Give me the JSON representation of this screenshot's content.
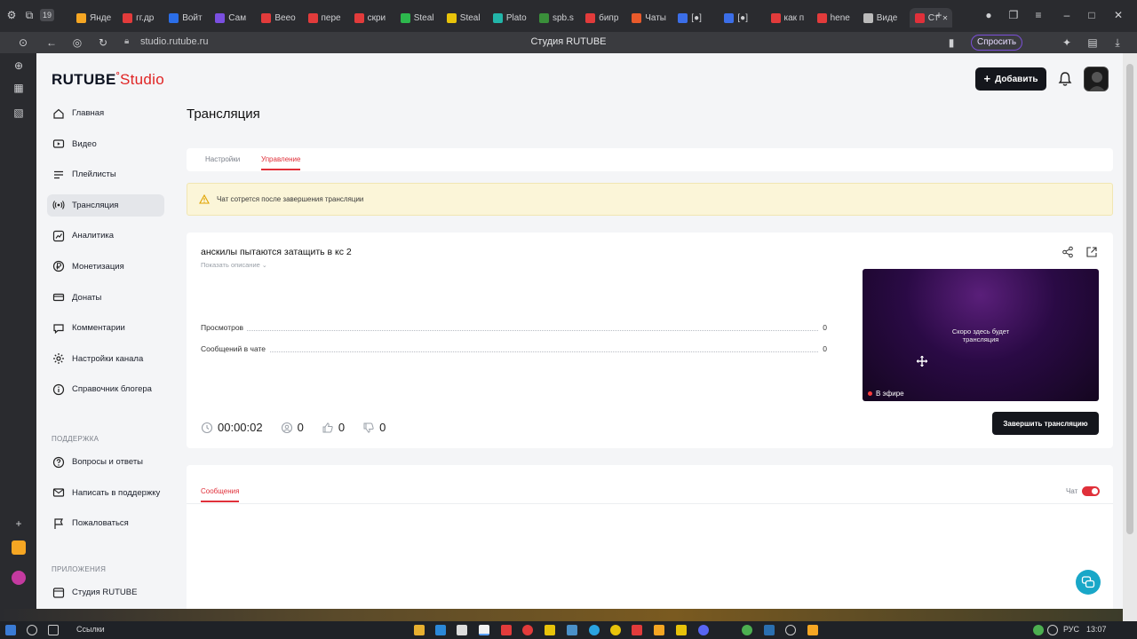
{
  "browser": {
    "tabs": [
      {
        "label": "Янде",
        "color": "#f5a623"
      },
      {
        "label": "гг.др",
        "color": "#e23b3b"
      },
      {
        "label": "Войт",
        "color": "#2b6ee8"
      },
      {
        "label": "Сам",
        "color": "#7a4fe0"
      },
      {
        "label": "Веео",
        "color": "#e23b3b"
      },
      {
        "label": "пере",
        "color": "#e23b3b"
      },
      {
        "label": "скри",
        "color": "#e23b3b"
      },
      {
        "label": "Steal",
        "color": "#2db84d"
      },
      {
        "label": "Steal",
        "color": "#e8c30a"
      },
      {
        "label": "Plato",
        "color": "#22b5a9"
      },
      {
        "label": "spb.s",
        "color": "#3a8f3a"
      },
      {
        "label": "бипр",
        "color": "#e23b3b"
      },
      {
        "label": "Чаты",
        "color": "#e85a2b"
      },
      {
        "label": "[●]",
        "color": "#3b6ee8"
      },
      {
        "label": "[●]",
        "color": "#3b6ee8"
      },
      {
        "label": "как п",
        "color": "#e23b3b"
      },
      {
        "label": "hene",
        "color": "#e23b3b"
      },
      {
        "label": "Виде",
        "color": "#bbbbbb"
      },
      {
        "label": "Ст",
        "color": "#e0303a"
      }
    ],
    "tab_count_badge": "19",
    "url": "studio.rutube.ru",
    "page_title": "Студия RUTUBE",
    "ask_label": "Спросить"
  },
  "header": {
    "logo_main": "RUTUBE",
    "logo_sub": "Studio",
    "add_label": "Добавить"
  },
  "sidebar": {
    "items": [
      {
        "label": "Главная",
        "icon": "home-icon"
      },
      {
        "label": "Видео",
        "icon": "video-icon"
      },
      {
        "label": "Плейлисты",
        "icon": "playlist-icon"
      },
      {
        "label": "Трансляция",
        "icon": "broadcast-icon",
        "active": true
      },
      {
        "label": "Аналитика",
        "icon": "chart-icon"
      },
      {
        "label": "Монетизация",
        "icon": "ruble-icon"
      },
      {
        "label": "Донаты",
        "icon": "donate-icon"
      },
      {
        "label": "Комментарии",
        "icon": "comment-icon"
      },
      {
        "label": "Настройки канала",
        "icon": "gear-icon"
      },
      {
        "label": "Справочник блогера",
        "icon": "info-icon"
      }
    ],
    "support_label": "ПОДДЕРЖКА",
    "support_items": [
      {
        "label": "Вопросы и ответы",
        "icon": "question-icon"
      },
      {
        "label": "Написать в поддержку",
        "icon": "mail-icon"
      },
      {
        "label": "Пожаловаться",
        "icon": "flag-icon"
      }
    ],
    "apps_label": "ПРИЛОЖЕНИЯ",
    "apps_items": [
      {
        "label": "Студия RUTUBE",
        "icon": "studio-app-icon"
      }
    ]
  },
  "main": {
    "title": "Трансляция",
    "tabs": [
      {
        "label": "Настройки"
      },
      {
        "label": "Управление",
        "active": true
      }
    ],
    "notice": "Чат сотрется после завершения трансляции",
    "stream": {
      "title": "анскилы пытаются затащить в кс 2",
      "show_description": "Показать описание",
      "stats": [
        {
          "label": "Просмотров",
          "value": "0"
        },
        {
          "label": "Сообщений в чате",
          "value": "0"
        }
      ],
      "duration": "00:00:02",
      "viewers": "0",
      "likes": "0",
      "dislikes": "0",
      "preview_text_1": "Скоро здесь будет",
      "preview_text_2": "трансляция",
      "live_label": "В эфире",
      "end_label": "Завершить трансляцию"
    },
    "chat": {
      "messages_tab": "Сообщения",
      "chat_toggle_label": "Чат",
      "chat_enabled": true
    }
  },
  "taskbar": {
    "search_label": "Ссылки",
    "lang": "РУС",
    "time": "13:07"
  },
  "colors": {
    "accent": "#e0303a",
    "dark_button": "#14161c",
    "notice_bg": "#fbf5d8",
    "help_fab": "#19a7c8"
  }
}
